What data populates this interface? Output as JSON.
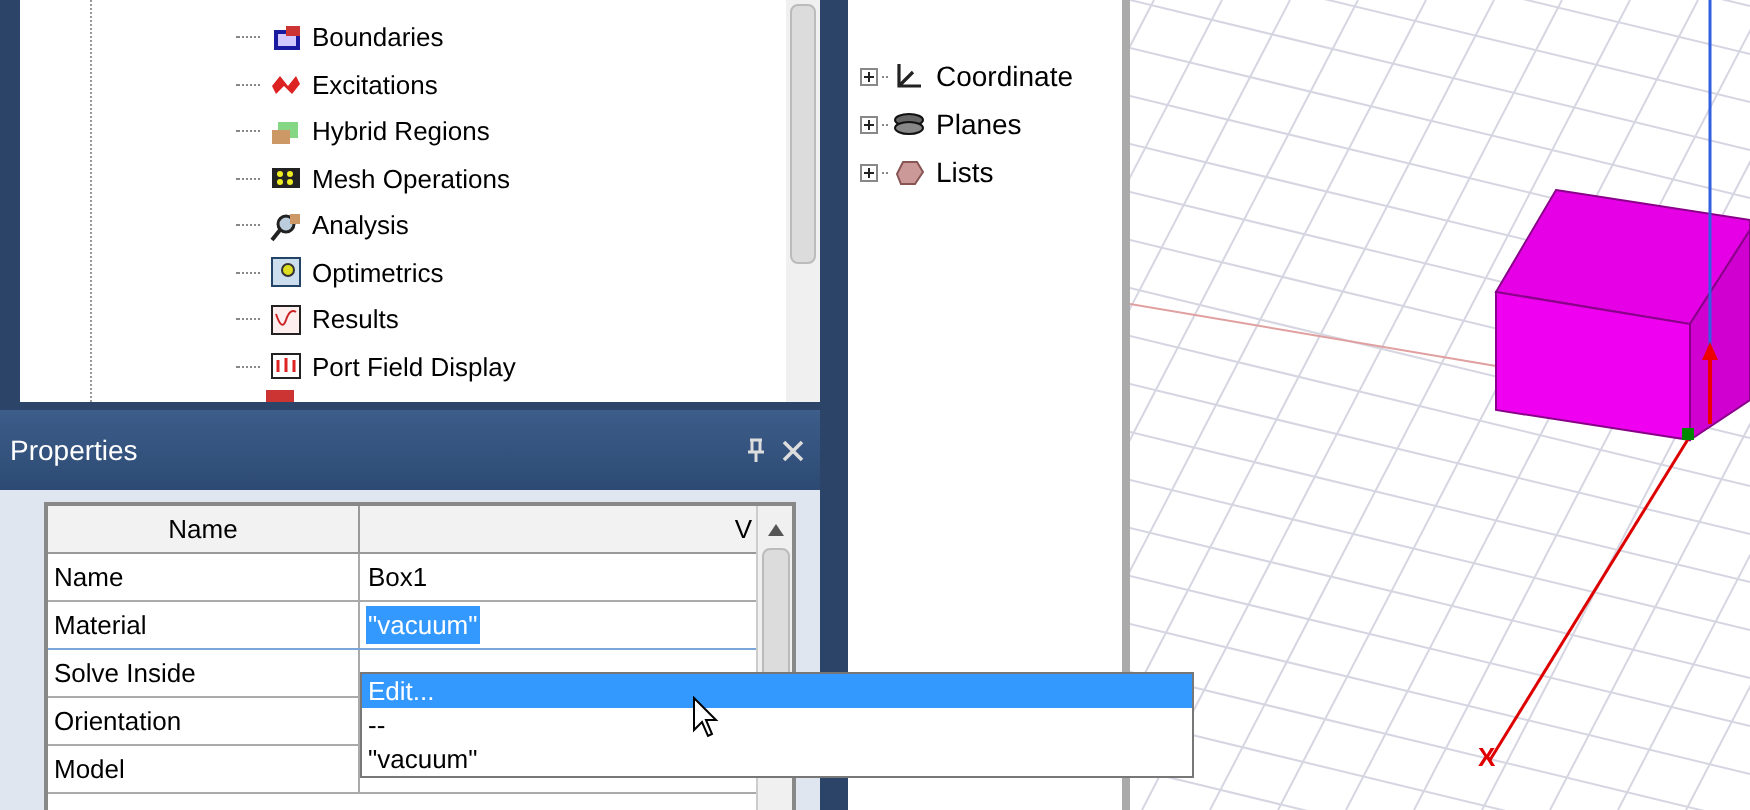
{
  "project_tree": {
    "items": [
      {
        "label": "Boundaries"
      },
      {
        "label": "Excitations"
      },
      {
        "label": "Hybrid Regions"
      },
      {
        "label": "Mesh Operations"
      },
      {
        "label": "Analysis"
      },
      {
        "label": "Optimetrics"
      },
      {
        "label": "Results"
      },
      {
        "label": "Port Field Display"
      }
    ]
  },
  "model_tree": {
    "items": [
      {
        "label": "Coordinate",
        "expanded": false
      },
      {
        "label": "Planes",
        "expanded": false
      },
      {
        "label": "Lists",
        "expanded": false
      }
    ]
  },
  "properties": {
    "title": "Properties",
    "columns": [
      "Name",
      "V"
    ],
    "rows": [
      {
        "name": "Name",
        "value": "Box1",
        "selected": false
      },
      {
        "name": "Material",
        "value": "\"vacuum\"",
        "selected": true
      },
      {
        "name": "Solve Inside",
        "value": "",
        "selected": false
      },
      {
        "name": "Orientation",
        "value": "",
        "selected": false
      },
      {
        "name": "Model",
        "value": "",
        "selected": false
      }
    ],
    "dropdown": [
      {
        "label": "Edit...",
        "selected": true
      },
      {
        "label": "--",
        "selected": false
      },
      {
        "label": "\"vacuum\"",
        "selected": false
      }
    ]
  },
  "viewport": {
    "axis_label": "X"
  }
}
